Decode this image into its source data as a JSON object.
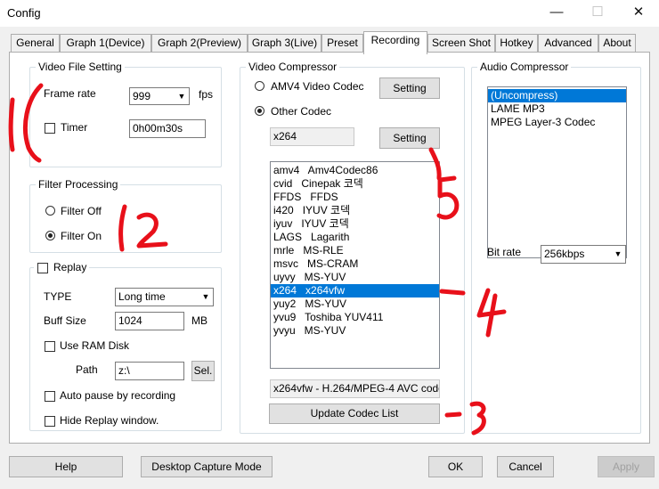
{
  "window": {
    "title": "Config",
    "minimize": "—",
    "maximize": "☐",
    "close": "✕"
  },
  "tabs": [
    "General",
    "Graph 1(Device)",
    "Graph 2(Preview)",
    "Graph 3(Live)",
    "Preset",
    "Recording",
    "Screen Shot",
    "Hotkey",
    "Advanced",
    "About"
  ],
  "active_tab": "Recording",
  "video_file": {
    "title": "Video File Setting",
    "frame_rate_label": "Frame rate",
    "frame_rate_value": "999",
    "fps_label": "fps",
    "timer_label": "Timer",
    "timer_value": "0h00m30s"
  },
  "filter": {
    "title": "Filter Processing",
    "off_label": "Filter Off",
    "on_label": "Filter On"
  },
  "replay": {
    "label": "Replay",
    "type_label": "TYPE",
    "type_value": "Long time",
    "buff_label": "Buff Size",
    "buff_value": "1024",
    "buff_unit": "MB",
    "ram_disk_label": "Use RAM Disk",
    "path_label": "Path",
    "path_value": "z:\\",
    "sel_button": "Sel.",
    "auto_pause_label": "Auto pause by recording",
    "hide_window_label": "Hide Replay window."
  },
  "video_compressor": {
    "title": "Video Compressor",
    "amv4_label": "AMV4 Video Codec",
    "other_label": "Other Codec",
    "setting_button": "Setting",
    "codec_field": "x264",
    "codecs": [
      "amv4   Amv4Codec86",
      "cvid   Cinepak 코덱",
      "FFDS   FFDS",
      "i420   IYUV 코덱",
      "iyuv   IYUV 코덱",
      "LAGS   Lagarith",
      "mrle   MS-RLE",
      "msvc   MS-CRAM",
      "uyvy   MS-YUV",
      "x264   x264vfw",
      "yuy2   MS-YUV",
      "yvu9   Toshiba YUV411",
      "yvyu   MS-YUV"
    ],
    "selected_index": 9,
    "description": "x264vfw - H.264/MPEG-4 AVC code",
    "update_button": "Update Codec List"
  },
  "audio_compressor": {
    "title": "Audio Compressor",
    "codecs": [
      "(Uncompress)",
      "LAME MP3",
      "MPEG Layer-3 Codec"
    ],
    "selected_index": 0,
    "bitrate_label": "Bit rate",
    "bitrate_value": "256kbps"
  },
  "footer": {
    "help": "Help",
    "desktop_capture": "Desktop Capture Mode",
    "ok": "OK",
    "cancel": "Cancel",
    "apply": "Apply"
  }
}
